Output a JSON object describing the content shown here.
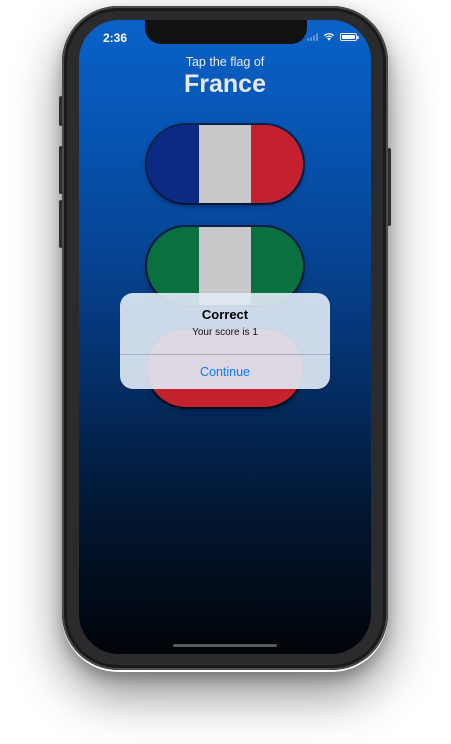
{
  "status_bar": {
    "time": "2:36",
    "icons": [
      "signal-icon",
      "wifi-icon",
      "battery-icon"
    ]
  },
  "header": {
    "prompt": "Tap the flag of",
    "country": "France"
  },
  "flags": [
    {
      "name": "France",
      "stripes": [
        "#0b2a84",
        "#c8c8ca",
        "#c4202e"
      ]
    },
    {
      "name": "Nigeria",
      "stripes": [
        "#0a7040",
        "#c8c8ca",
        "#0a7040"
      ]
    },
    {
      "name": "hidden-flag",
      "stripes": [
        "#c4222c",
        "#c4222c",
        "#c4222c"
      ]
    }
  ],
  "alert": {
    "title": "Correct",
    "message": "Your score is 1",
    "action_label": "Continue"
  },
  "colors": {
    "background_top": "#0a62c8",
    "background_bottom": "#010408",
    "alert_action": "#0a7aff"
  }
}
